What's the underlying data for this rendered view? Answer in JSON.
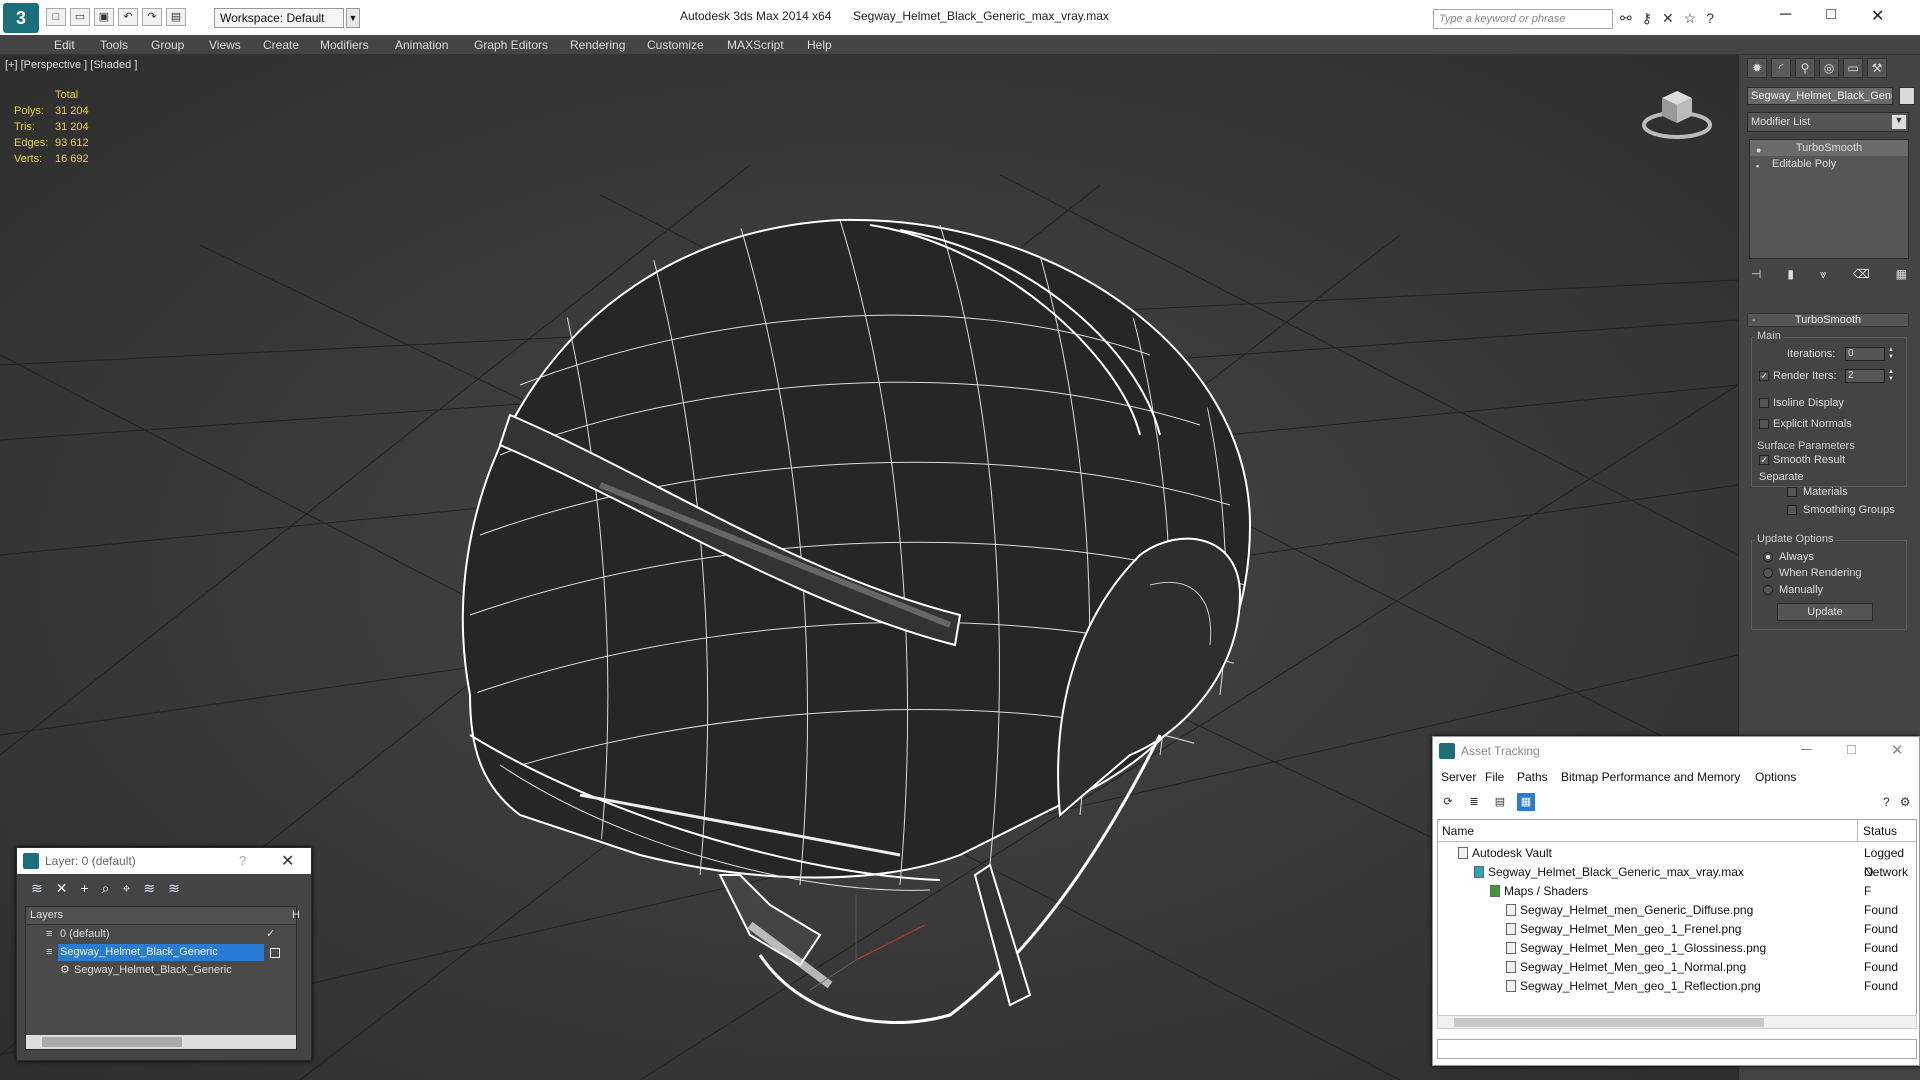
{
  "title": {
    "app": "Autodesk 3ds Max  2014 x64",
    "file": "Segway_Helmet_Black_Generic_max_vray.max",
    "workspace": "Workspace: Default",
    "search_placeholder": "Type a keyword or phrase"
  },
  "menu": [
    "Edit",
    "Tools",
    "Group",
    "Views",
    "Create",
    "Modifiers",
    "Animation",
    "Graph Editors",
    "Rendering",
    "Customize",
    "MAXScript",
    "Help"
  ],
  "viewport": {
    "label": "[+] [Perspective ] [Shaded ]",
    "stats_header": "Total",
    "stats": [
      {
        "k": "Polys:",
        "v": "31 204"
      },
      {
        "k": "Tris:",
        "v": "31 204"
      },
      {
        "k": "Edges:",
        "v": "93 612"
      },
      {
        "k": "Verts:",
        "v": "16 692"
      }
    ]
  },
  "command_panel": {
    "object_name": "Segway_Helmet_Black_Generic",
    "modifier_list": "Modifier List",
    "stack": [
      "TurboSmooth",
      "Editable Poly"
    ],
    "rollout": "TurboSmooth",
    "main": "Main",
    "iterations_label": "Iterations:",
    "iterations": "0",
    "render_iters_label": "Render Iters:",
    "render_iters": "2",
    "isoline": "Isoline Display",
    "explicit": "Explicit Normals",
    "surface": "Surface Parameters",
    "smooth_result": "Smooth Result",
    "separate": "Separate",
    "materials": "Materials",
    "smoothing_groups": "Smoothing Groups",
    "update_options": "Update Options",
    "always": "Always",
    "when_rendering": "When Rendering",
    "manually": "Manually",
    "update": "Update"
  },
  "layer_window": {
    "title": "Layer: 0 (default)",
    "help": "?",
    "header": "Layers",
    "header_h": "H",
    "rows": [
      "0 (default)",
      "Segway_Helmet_Black_Generic",
      "Segway_Helmet_Black_Generic"
    ]
  },
  "asset_window": {
    "title": "Asset Tracking",
    "menu": [
      "Server",
      "File",
      "Paths",
      "Bitmap Performance and Memory",
      "Options"
    ],
    "col_name": "Name",
    "col_status": "Status",
    "rows": [
      {
        "name": "Autodesk Vault",
        "status": "Logged O"
      },
      {
        "name": "Segway_Helmet_Black_Generic_max_vray.max",
        "status": "Network F"
      },
      {
        "name": "Maps / Shaders",
        "status": ""
      },
      {
        "name": "Segway_Helmet_men_Generic_Diffuse.png",
        "status": "Found"
      },
      {
        "name": "Segway_Helmet_Men_geo_1_Frenel.png",
        "status": "Found"
      },
      {
        "name": "Segway_Helmet_Men_geo_1_Glossiness.png",
        "status": "Found"
      },
      {
        "name": "Segway_Helmet_Men_geo_1_Normal.png",
        "status": "Found"
      },
      {
        "name": "Segway_Helmet_Men_geo_1_Reflection.png",
        "status": "Found"
      }
    ]
  }
}
